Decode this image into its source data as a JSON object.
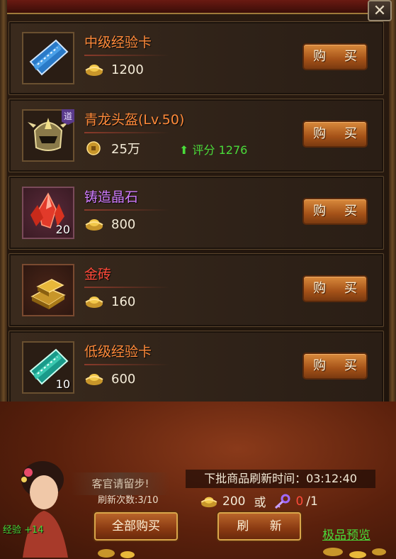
{
  "shop": {
    "close_icon": "close-icon",
    "items": [
      {
        "name": "中级经验卡",
        "price": "1200",
        "currency": "gold-ingot",
        "icon": "blue-exp-card-icon",
        "count": "",
        "score": "",
        "buy_label": "购 买"
      },
      {
        "name": "青龙头盔(Lv.50)",
        "price": "25万",
        "currency": "copper-coin",
        "icon": "dragon-helmet-icon",
        "count": "",
        "tag": "道",
        "score": "评分 1276",
        "buy_label": "购 买"
      },
      {
        "name": "铸造晶石",
        "price": "800",
        "currency": "gold-ingot",
        "icon": "red-crystal-icon",
        "count": "20",
        "score": "",
        "buy_label": "购 买"
      },
      {
        "name": "金砖",
        "price": "160",
        "currency": "gold-ingot",
        "icon": "gold-brick-icon",
        "count": "",
        "score": "",
        "buy_label": "购 买"
      },
      {
        "name": "低级经验卡",
        "price": "600",
        "currency": "gold-ingot",
        "icon": "green-exp-card-icon",
        "count": "10",
        "score": "",
        "buy_label": "购 买"
      }
    ]
  },
  "footer": {
    "npc_greeting": "客官请留步!",
    "refresh_count": "刷新次数:3/10",
    "refresh_time": "下批商品刷新时间：03:12:40",
    "refresh_cost": "200",
    "or_label": "或",
    "key_have": "0",
    "key_need": "/1",
    "buy_all_label": "全部购买",
    "refresh_label": "刷 新",
    "preview_label": "极品预览",
    "exp_label": "经验 +14"
  },
  "colors": {
    "orange_name": "#ff8a3a",
    "purple_name": "#d07cff",
    "red_name": "#ff4a3a",
    "green_text": "#4adc3a"
  }
}
